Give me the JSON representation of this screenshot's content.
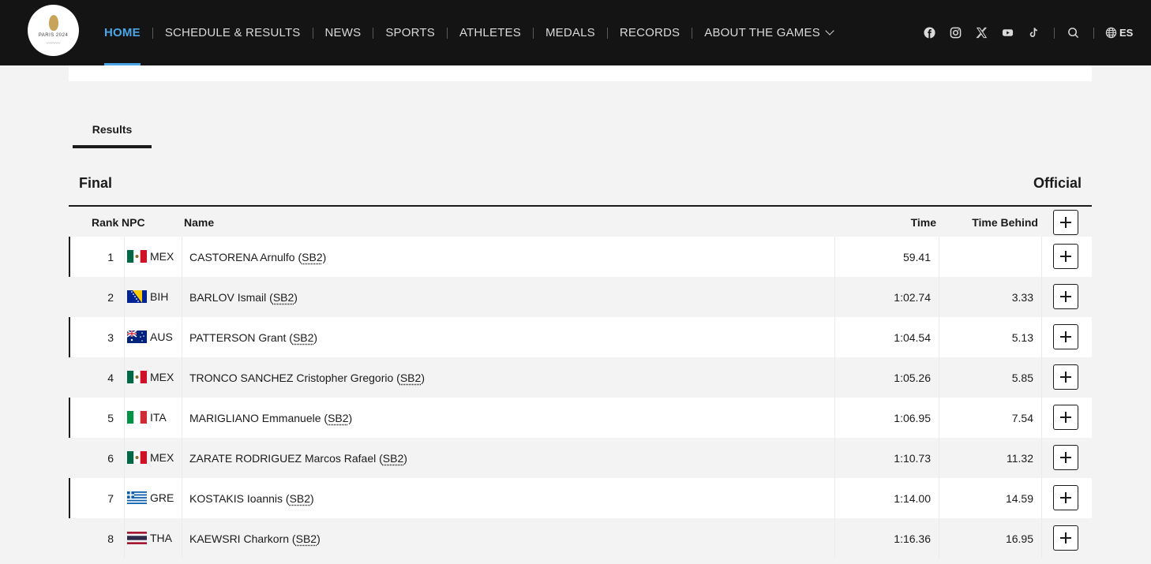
{
  "header": {
    "logo_text": "PARIS 2024",
    "nav": [
      {
        "label": "HOME",
        "active": true
      },
      {
        "label": "SCHEDULE & RESULTS",
        "active": false
      },
      {
        "label": "NEWS",
        "active": false
      },
      {
        "label": "SPORTS",
        "active": false
      },
      {
        "label": "ATHLETES",
        "active": false
      },
      {
        "label": "MEDALS",
        "active": false
      },
      {
        "label": "RECORDS",
        "active": false
      },
      {
        "label": "ABOUT THE GAMES",
        "active": false
      }
    ],
    "social_icons": [
      "facebook-icon",
      "instagram-icon",
      "x-icon",
      "youtube-icon",
      "tiktok-icon"
    ],
    "language": "ES",
    "accent": "#4aa6e6"
  },
  "tabs": [
    "Results"
  ],
  "phase": "Final",
  "status": "Official",
  "table": {
    "headers": {
      "rank": "Rank",
      "npc": "NPC",
      "name": "Name",
      "time": "Time",
      "behind": "Time Behind"
    },
    "rows": [
      {
        "rank": "1",
        "npc": "MEX",
        "name": "CASTORENA Arnulfo",
        "cls": "SB2",
        "time": "59.41",
        "behind": ""
      },
      {
        "rank": "2",
        "npc": "BIH",
        "name": "BARLOV Ismail",
        "cls": "SB2",
        "time": "1:02.74",
        "behind": "3.33"
      },
      {
        "rank": "3",
        "npc": "AUS",
        "name": "PATTERSON Grant",
        "cls": "SB2",
        "time": "1:04.54",
        "behind": "5.13"
      },
      {
        "rank": "4",
        "npc": "MEX",
        "name": "TRONCO SANCHEZ Cristopher Gregorio",
        "cls": "SB2",
        "time": "1:05.26",
        "behind": "5.85"
      },
      {
        "rank": "5",
        "npc": "ITA",
        "name": "MARIGLIANO Emmanuele",
        "cls": "SB2",
        "time": "1:06.95",
        "behind": "7.54"
      },
      {
        "rank": "6",
        "npc": "MEX",
        "name": "ZARATE RODRIGUEZ Marcos Rafael",
        "cls": "SB2",
        "time": "1:10.73",
        "behind": "11.32"
      },
      {
        "rank": "7",
        "npc": "GRE",
        "name": "KOSTAKIS Ioannis",
        "cls": "SB2",
        "time": "1:14.00",
        "behind": "14.59"
      },
      {
        "rank": "8",
        "npc": "THA",
        "name": "KAEWSRI Charkorn",
        "cls": "SB2",
        "time": "1:16.36",
        "behind": "16.95"
      }
    ]
  }
}
